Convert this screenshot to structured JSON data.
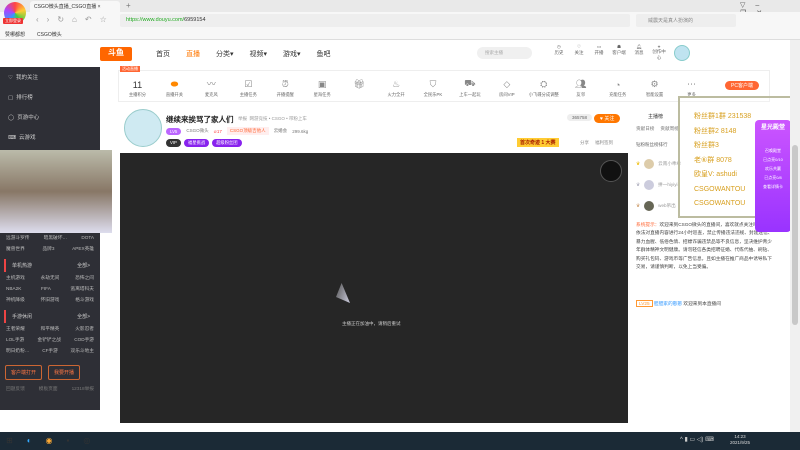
{
  "browser": {
    "tab_title": "CSGO微头直播_CSGO直播",
    "login_tag": "立即登录",
    "url_host": "https://www.douyu.com/",
    "url_path": "6959154",
    "search_placeholder": "威震天是真人扮演的",
    "bookmarks": [
      "赞哪都想",
      "CSGO微头"
    ],
    "new_tab": "+"
  },
  "header": {
    "logo": "斗鱼",
    "nav": [
      "首页",
      "直播",
      "分类▾",
      "视频▾",
      "游戏▾",
      "鱼吧"
    ],
    "search_placeholder": "搜索主播",
    "icons": [
      "历史",
      "关注",
      "开播",
      "客户端",
      "消息",
      "创作中心"
    ]
  },
  "sidebar": {
    "items": [
      "我的关注",
      "排行榜",
      "页游中心",
      "云游戏"
    ],
    "games_top": [
      [
        "远游斗罗传",
        "暗黑破坏…",
        "DOTA"
      ],
      [
        "魔兽世界",
        "品牌3",
        "APEX英雄"
      ]
    ],
    "section1": "单机热游",
    "section1_all": "全部>",
    "games1": [
      [
        "主机游戏",
        "永劫无间",
        "恐怖之间"
      ],
      [
        "NBA2K",
        "FIFA",
        "逃离塔科夫"
      ],
      [
        "神机降级",
        "怀旧游戏",
        "格斗游戏"
      ]
    ],
    "section2": "手游休闲",
    "section2_all": "全部>",
    "games2": [
      [
        "王者荣耀",
        "和平精英",
        "火影忍者"
      ],
      [
        "LOL手游",
        "金铲铲之战",
        "COD手游"
      ],
      [
        "明日奶粉…",
        "CF手游",
        "双乐斗地主"
      ]
    ],
    "btn_client": "客户端打开",
    "btn_live": "我要开播",
    "footer": [
      "回题反馈",
      "模板页面",
      "12318举报"
    ]
  },
  "toolbar": {
    "badge": "活动直播",
    "score": "11",
    "items": [
      "主播积分",
      "直播开关",
      "麦克风",
      "主播任务",
      "开播提醒",
      "星海任务",
      "礼物",
      "火力全开",
      "全民乐PK",
      "上车一起玩",
      "房间VIP",
      "小飞碟分成调整",
      "友邻",
      "充能任务",
      "智能设置",
      "更多"
    ],
    "pc_client": "PC客户端"
  },
  "room": {
    "title": "继续来挨骂了家人们",
    "report": "举报",
    "category": "网游竞技 • CSGO • 带粉上车",
    "level": "LV5",
    "streamer": "CSGO微头",
    "heat": "17",
    "tag": "CSGO顶级吉他人",
    "guild": "云婚会",
    "weight": "299.6kg",
    "badges": [
      "VIP",
      "福星挑战",
      "超级粉丝团"
    ],
    "follow_count": "365758",
    "follow": "关注",
    "banner": "首次奇迹 1 大赛",
    "share": "分享",
    "sign": "福利签到",
    "video_message": "主播正在加油中，请稍后重试"
  },
  "chat": {
    "host_rank": "主播榜",
    "tabs": [
      "贡献日榜",
      "贡献周榜"
    ],
    "rank_title": "钻粉粉丝榜排行",
    "ranks": [
      "云南小乖乖",
      "拼一hiyiyi",
      "web吊出"
    ],
    "notice_label": "系统提示：",
    "notice": "欢迎来到CSGO微头的直播间，喜欢就点关注吧。斗鱼依法对直播内容进行24小时巡查，禁止传播违法违规、封建迷信、暴力血腥、低俗色情、招嫖诈骗违禁品等不良信息，坚决维护青少年群体精神文明健康。请勿轻信各类招聘征婚、代练代抽、刷钻、购买礼包码、游戏币等广告信息，且如主播在推广商品中诱导私下交易，请谨慎判断，以免上当受骗。",
    "welcome_level": "LV25",
    "welcome_user": "胆胆家的憨憨",
    "welcome_text": "欢迎来到本直播间"
  },
  "overlay": {
    "lines": [
      "粉丝群1群 231538",
      "粉丝群2 8148",
      "粉丝群3",
      "老⑥群 8078",
      "欧皇V: ashudi",
      "CSGOWANTOU",
      "CSGOWANTOU"
    ],
    "promo": [
      "星光殿堂",
      "召唤殿堂",
      "已点亮0/10",
      "欢乐共赢",
      "已点亮0/8",
      "查看详情卡"
    ]
  },
  "taskbar": {
    "time": "14:23",
    "date": "2021/9/25"
  }
}
